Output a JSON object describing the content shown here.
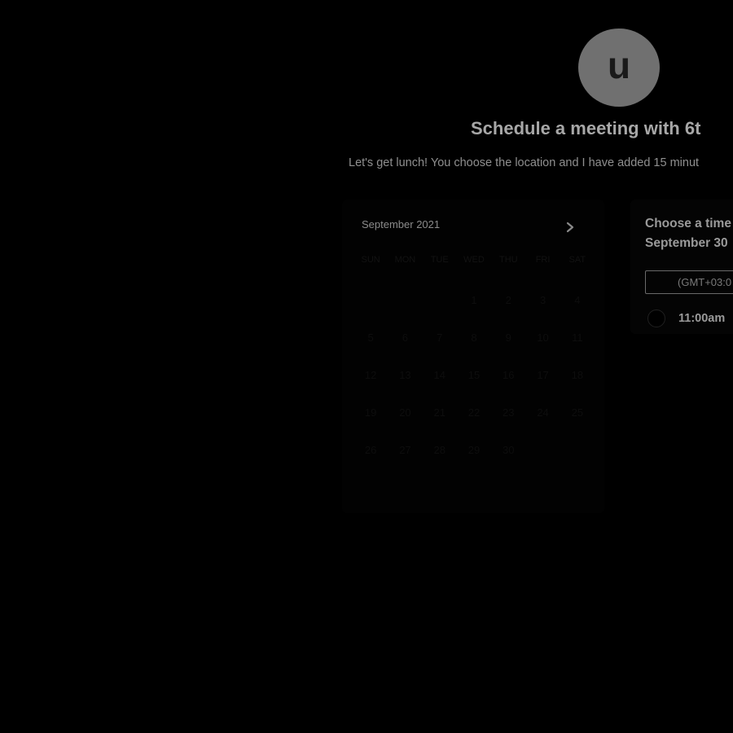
{
  "avatar": {
    "initial": "u"
  },
  "header": {
    "title": "Schedule a meeting with 6t",
    "subtitle": "Let's get lunch! You choose the location and I have added 15 minut"
  },
  "calendar": {
    "month_label": "September 2021",
    "next_icon": "chevron-right-icon",
    "weekdays": [
      "SUN",
      "MON",
      "TUE",
      "WED",
      "THU",
      "FRI",
      "SAT"
    ],
    "days": [
      "",
      "",
      "",
      "1",
      "2",
      "3",
      "4",
      "5",
      "6",
      "7",
      "8",
      "9",
      "10",
      "11",
      "12",
      "13",
      "14",
      "15",
      "16",
      "17",
      "18",
      "19",
      "20",
      "21",
      "22",
      "23",
      "24",
      "25",
      "26",
      "27",
      "28",
      "29",
      "30",
      "",
      ""
    ]
  },
  "time_panel": {
    "heading_line1": "Choose a time",
    "heading_line2": "September 30",
    "timezone": "(GMT+03:0",
    "slots": [
      {
        "label": "11:00am"
      }
    ]
  },
  "colors": {
    "background": "#000000",
    "avatar": "#707070",
    "text_primary": "#a7a7a7"
  }
}
